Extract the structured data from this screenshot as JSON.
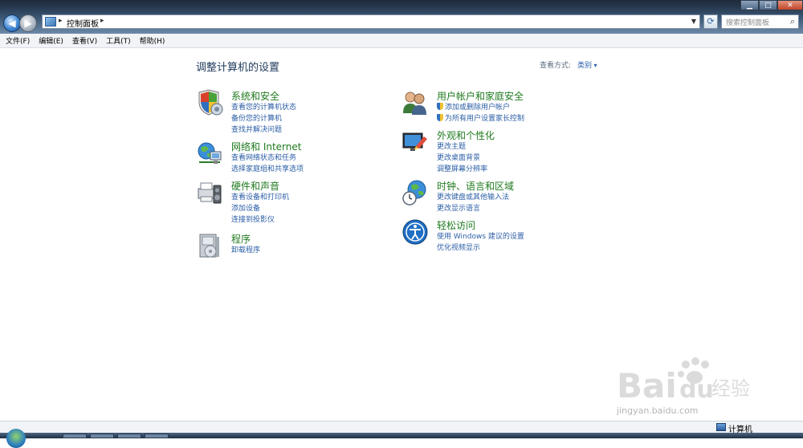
{
  "window": {
    "address_crumb": "控制面板",
    "search_placeholder": "搜索控制面板",
    "buttons": {
      "minimize": "▁",
      "maximize": "□",
      "close": "✕"
    }
  },
  "menu": [
    {
      "label": "文件(F)"
    },
    {
      "label": "编辑(E)"
    },
    {
      "label": "查看(V)"
    },
    {
      "label": "工具(T)"
    },
    {
      "label": "帮助(H)"
    }
  ],
  "main": {
    "title": "调整计算机的设置",
    "view_by_label": "查看方式:",
    "view_by_value": "类别"
  },
  "categories": [
    {
      "heading": "系统和安全",
      "icon": "shield-computer-icon",
      "links": [
        "查看您的计算机状态",
        "备份您的计算机",
        "查找并解决问题"
      ]
    },
    {
      "heading": "网络和 Internet",
      "icon": "network-globe-icon",
      "links": [
        "查看网络状态和任务",
        "选择家庭组和共享选项"
      ]
    },
    {
      "heading": "硬件和声音",
      "icon": "printer-speaker-icon",
      "links": [
        "查看设备和打印机",
        "添加设备",
        "连接到投影仪"
      ]
    },
    {
      "heading": "程序",
      "icon": "programs-box-icon",
      "links": [
        "卸载程序"
      ]
    },
    {
      "heading": "用户帐户和家庭安全",
      "icon": "users-icon",
      "links": [
        "添加或删除用户帐户",
        "为所有用户设置家长控制"
      ]
    },
    {
      "heading": "外观和个性化",
      "icon": "monitor-paint-icon",
      "links": [
        "更改主题",
        "更改桌面背景",
        "调整屏幕分辨率"
      ]
    },
    {
      "heading": "时钟、语言和区域",
      "icon": "globe-clock-icon",
      "links": [
        "更改键盘或其他输入法",
        "更改显示语言"
      ]
    },
    {
      "heading": "轻松访问",
      "icon": "ease-of-access-icon",
      "links": [
        "使用 Windows 建议的设置",
        "优化视频显示"
      ]
    }
  ],
  "status": {
    "computer_label": "计算机"
  },
  "watermark": {
    "brand": "Bai du 经验",
    "url": "jingyan.baidu.com"
  },
  "colors": {
    "heading_green": "#1f7a1f",
    "link_blue": "#2b5ea6",
    "title_navy": "#1e395b"
  }
}
